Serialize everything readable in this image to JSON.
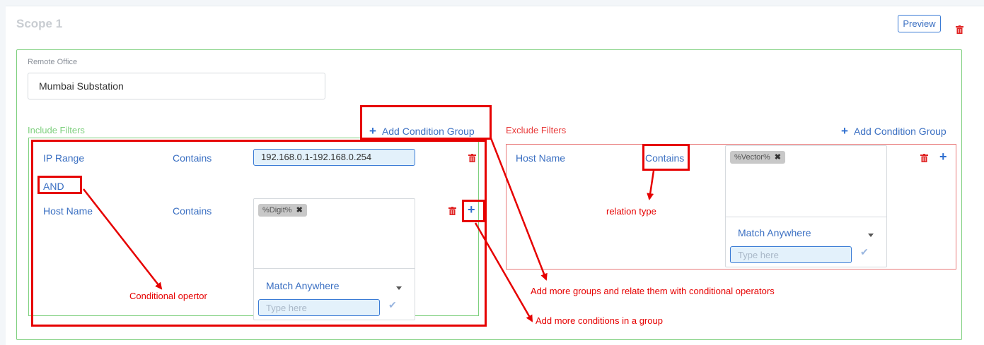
{
  "scope": {
    "title": "Scope 1",
    "preview_label": "Preview",
    "remote_office_label": "Remote Office",
    "remote_office_value": "Mumbai Substation"
  },
  "include": {
    "label": "Include Filters",
    "add_group_label": "Add Condition Group",
    "conditions": [
      {
        "field": "IP Range",
        "relation": "Contains",
        "value": "192.168.0.1-192.168.0.254"
      },
      {
        "field": "Host Name",
        "relation": "Contains",
        "tag": "%Digit%",
        "match": "Match Anywhere",
        "placeholder": "Type here"
      }
    ],
    "operator": "AND"
  },
  "exclude": {
    "label": "Exclude Filters",
    "add_group_label": "Add Condition Group",
    "conditions": [
      {
        "field": "Host Name",
        "relation": "Contains",
        "tag": "%Vector%",
        "match": "Match Anywhere",
        "placeholder": "Type here"
      }
    ]
  },
  "annotations": {
    "conditional_operator": "Conditional opertor",
    "relation_type": "relation type",
    "add_groups": "Add more groups and relate them with conditional operators",
    "add_conditions": "Add more conditions in a group"
  },
  "colors": {
    "accent_blue": "#3a6fc2",
    "include_green": "#7ed07e",
    "exclude_red": "#e83a3a",
    "annotation_red": "#e60000"
  },
  "icons": [
    "trash-icon",
    "plus-icon",
    "chevron-down-icon",
    "check-icon",
    "close-icon"
  ]
}
